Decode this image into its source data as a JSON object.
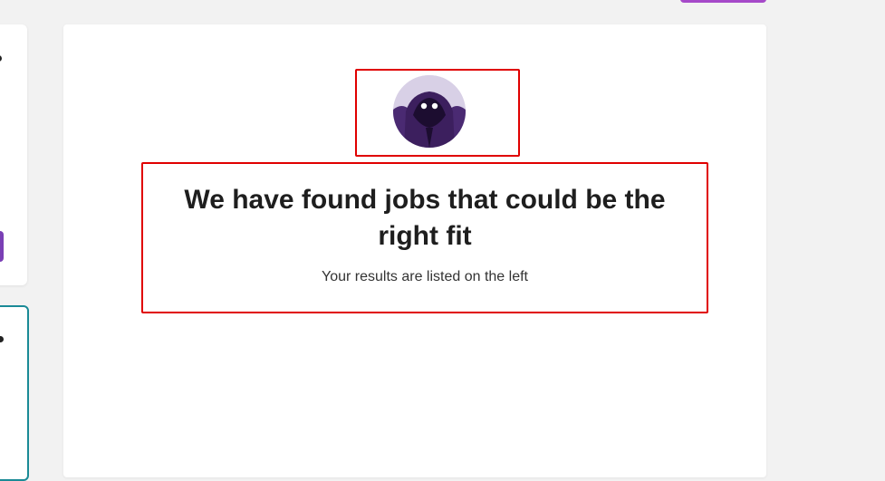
{
  "results": {
    "avatar_icon": "hooded-figure-icon",
    "headline": "We have found jobs that could be the right fit",
    "subtext": "Your results are listed on the left"
  },
  "colors": {
    "accent_purple": "#a64ac9",
    "highlight_border": "#e00000",
    "selected_card_border": "#1a8a96"
  }
}
